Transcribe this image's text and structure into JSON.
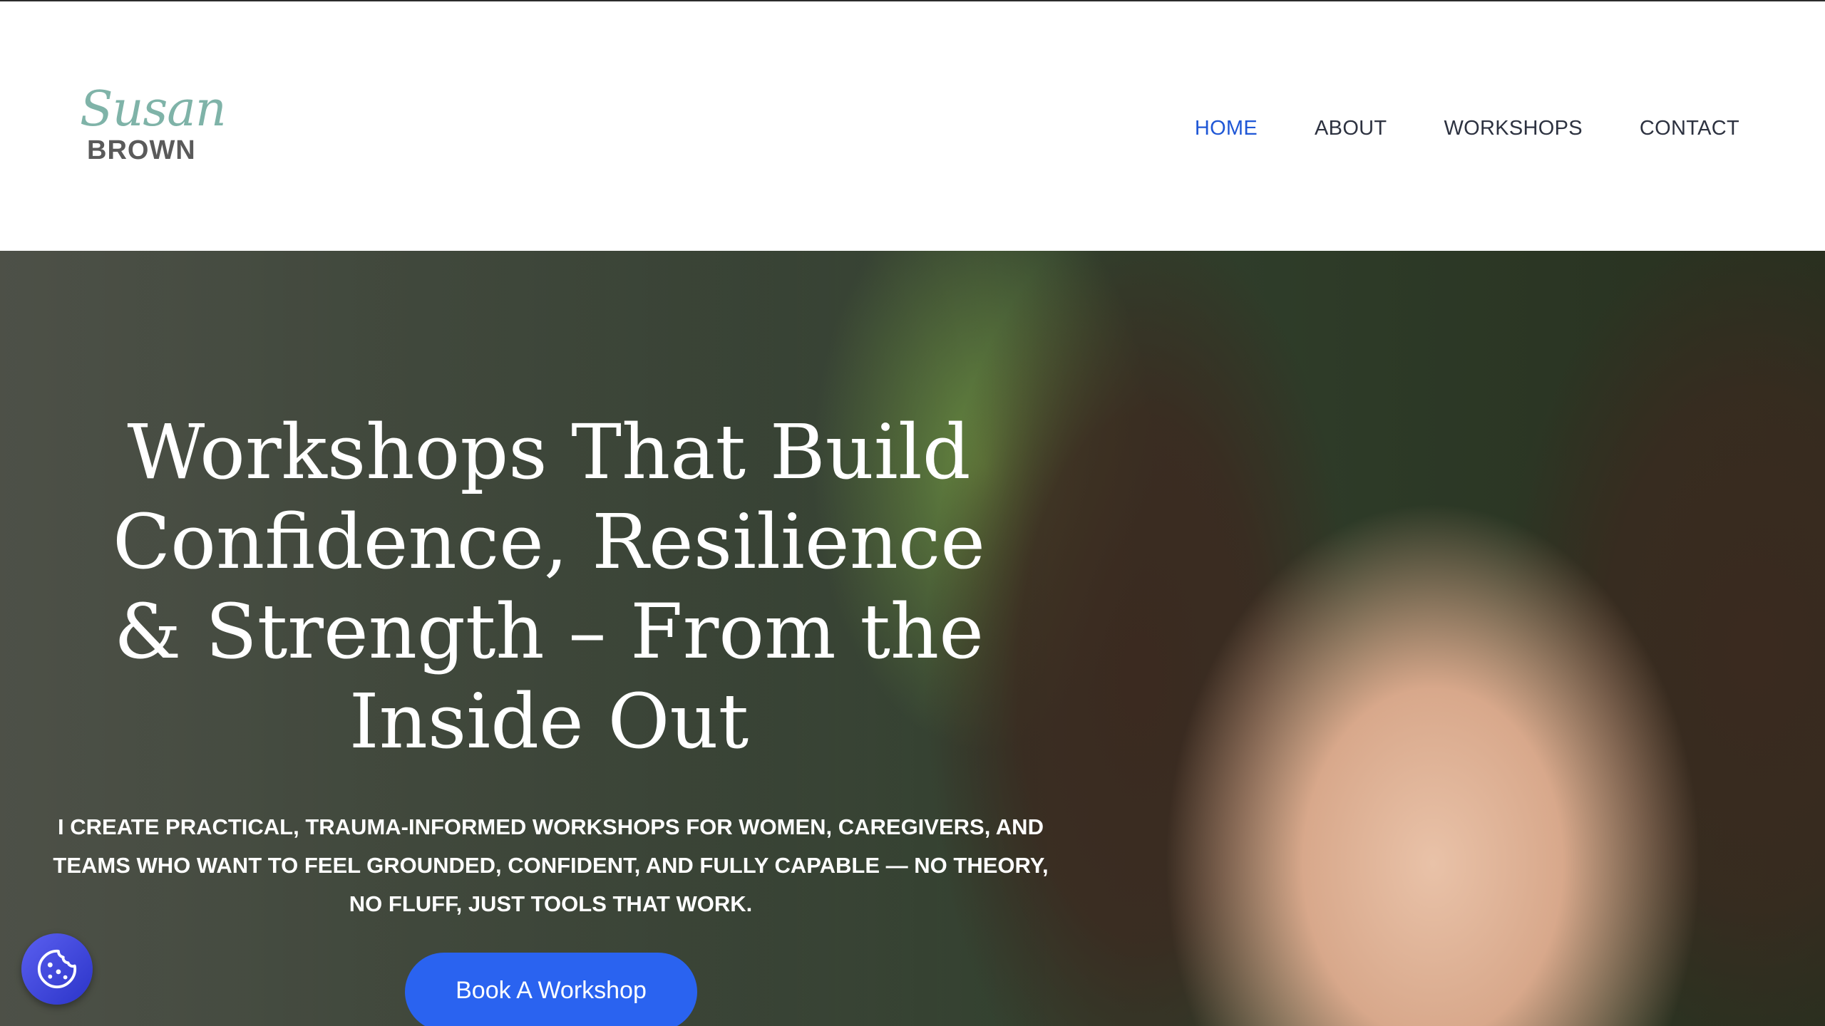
{
  "header": {
    "logo_script": "Susan",
    "logo_name": "BROWN",
    "nav": [
      {
        "label": "HOME",
        "active": true
      },
      {
        "label": "ABOUT",
        "active": false
      },
      {
        "label": "WORKSHOPS",
        "active": false
      },
      {
        "label": "CONTACT",
        "active": false
      }
    ]
  },
  "hero": {
    "title": "Workshops That Build Confidence, Resilience & Strength – From the Inside Out",
    "subtitle": "I create practical, trauma-informed workshops for women, caregivers, and teams who want to feel grounded, confident, and fully capable — no theory, no fluff, just tools that work.",
    "cta_label": "Book A Workshop",
    "image_description_icon": "smiling-woman-photo"
  },
  "cookie": {
    "icon": "cookie-icon"
  },
  "colors": {
    "accent": "#2a63f0",
    "nav_active": "#1f57d6",
    "nav_text": "#2d3240",
    "logo_script": "#7fb3a8",
    "logo_name": "#5a5a5a"
  }
}
